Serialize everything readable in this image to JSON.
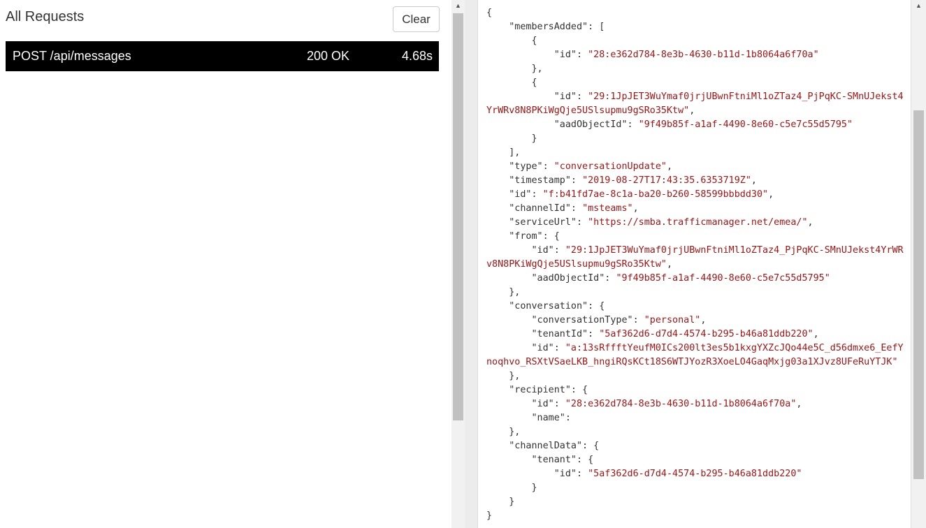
{
  "left": {
    "title": "All Requests",
    "clear_label": "Clear",
    "requests": [
      {
        "method_path": "POST /api/messages",
        "status": "200 OK",
        "time": "4.68s"
      }
    ]
  },
  "scroll_icons": {
    "up": "triangle-up-icon"
  },
  "json_lines": [
    [
      {
        "t": "{"
      }
    ],
    [
      {
        "t": "    \"membersAdded\": ["
      }
    ],
    [
      {
        "t": "        {"
      }
    ],
    [
      {
        "t": "            \"id\": "
      },
      {
        "t": "\"28:e362d784-8e3b-4630-b11d-1b8064a6f70a\"",
        "s": 1
      }
    ],
    [
      {
        "t": "        },"
      }
    ],
    [
      {
        "t": "        {"
      }
    ],
    [
      {
        "t": "            \"id\": "
      },
      {
        "t": "\"29:1JpJET3WuYmaf0jrjUBwnFtniMl1oZTaz4_PjPqKC-SMnUJekst4",
        "s": 1
      }
    ],
    [
      {
        "t": "YrWRv8N8PKiWgQje5USlsupmu9gSRo35Ktw\"",
        "s": 1
      },
      {
        "t": ","
      }
    ],
    [
      {
        "t": "            \"aadObjectId\": "
      },
      {
        "t": "\"9f49b85f-a1af-4490-8e60-c5e7c55d5795\"",
        "s": 1
      }
    ],
    [
      {
        "t": "        }"
      }
    ],
    [
      {
        "t": "    ],"
      }
    ],
    [
      {
        "t": "    \"type\": "
      },
      {
        "t": "\"conversationUpdate\"",
        "s": 1
      },
      {
        "t": ","
      }
    ],
    [
      {
        "t": "    \"timestamp\": "
      },
      {
        "t": "\"2019-08-27T17:43:35.6353719Z\"",
        "s": 1
      },
      {
        "t": ","
      }
    ],
    [
      {
        "t": "    \"id\": "
      },
      {
        "t": "\"f:b41fd7ae-8c1a-ba20-b260-58599bbbdd30\"",
        "s": 1
      },
      {
        "t": ","
      }
    ],
    [
      {
        "t": "    \"channelId\": "
      },
      {
        "t": "\"msteams\"",
        "s": 1
      },
      {
        "t": ","
      }
    ],
    [
      {
        "t": "    \"serviceUrl\": "
      },
      {
        "t": "\"https://smba.trafficmanager.net/emea/\"",
        "s": 1
      },
      {
        "t": ","
      }
    ],
    [
      {
        "t": "    \"from\": {"
      }
    ],
    [
      {
        "t": "        \"id\": "
      },
      {
        "t": "\"29:1JpJET3WuYmaf0jrjUBwnFtniMl1oZTaz4_PjPqKC-SMnUJekst4YrWR",
        "s": 1
      }
    ],
    [
      {
        "t": "v8N8PKiWgQje5USlsupmu9gSRo35Ktw\"",
        "s": 1
      },
      {
        "t": ","
      }
    ],
    [
      {
        "t": "        \"aadObjectId\": "
      },
      {
        "t": "\"9f49b85f-a1af-4490-8e60-c5e7c55d5795\"",
        "s": 1
      }
    ],
    [
      {
        "t": "    },"
      }
    ],
    [
      {
        "t": "    \"conversation\": {"
      }
    ],
    [
      {
        "t": "        \"conversationType\": "
      },
      {
        "t": "\"personal\"",
        "s": 1
      },
      {
        "t": ","
      }
    ],
    [
      {
        "t": "        \"tenantId\": "
      },
      {
        "t": "\"5af362d6-d7d4-4574-b295-b46a81ddb220\"",
        "s": 1
      },
      {
        "t": ","
      }
    ],
    [
      {
        "t": "        \"id\": "
      },
      {
        "t": "\"a:13sRffftYeufM0ICs200lt3es5b1kxgYXZcJQo44e5C_d56dmxe6_EefY",
        "s": 1
      }
    ],
    [
      {
        "t": "noqhvo_RSXtVSaeLKB_hngiRQsKCt18S6WTJYozR3XoeLO4GaqMxjg03a1XJvz8UFeRuYTJK\"",
        "s": 1
      }
    ],
    [
      {
        "t": "    },"
      }
    ],
    [
      {
        "t": "    \"recipient\": {"
      }
    ],
    [
      {
        "t": "        \"id\": "
      },
      {
        "t": "\"28:e362d784-8e3b-4630-b11d-1b8064a6f70a\"",
        "s": 1
      },
      {
        "t": ","
      }
    ],
    [
      {
        "t": "        \"name\":"
      }
    ],
    [
      {
        "t": "    },"
      }
    ],
    [
      {
        "t": "    \"channelData\": {"
      }
    ],
    [
      {
        "t": "        \"tenant\": {"
      }
    ],
    [
      {
        "t": "            \"id\": "
      },
      {
        "t": "\"5af362d6-d7d4-4574-b295-b46a81ddb220\"",
        "s": 1
      }
    ],
    [
      {
        "t": "        }"
      }
    ],
    [
      {
        "t": "    }"
      }
    ],
    [
      {
        "t": "}"
      }
    ]
  ]
}
